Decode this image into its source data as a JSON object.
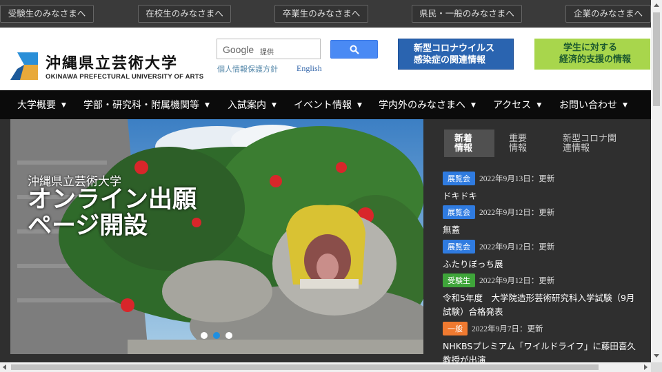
{
  "audience": [
    "受験生のみなさまへ",
    "在校生のみなさまへ",
    "卒業生のみなさまへ",
    "県民・一般のみなさまへ",
    "企業のみなさまへ"
  ],
  "logo": {
    "jp": "沖縄県立芸術大学",
    "en": "OKINAWA PREFECTURAL UNIVERSITY OF ARTS"
  },
  "search": {
    "brand": "Google",
    "provided": "提供",
    "button_icon": "search-icon"
  },
  "links": {
    "privacy": "個人情報保護方針",
    "english": "English"
  },
  "banners": {
    "covid": [
      "新型コロナウイルス",
      "感染症の関連情報"
    ],
    "support": [
      "学生に対する",
      "経済的支援の情報"
    ]
  },
  "nav": [
    "大学概要",
    "学部・研究科・附属機関等",
    "入試案内",
    "イベント情報",
    "学内外のみなさまへ",
    "アクセス",
    "お問い合わせ"
  ],
  "nav_caret": "▼",
  "hero": {
    "subtitle": "沖縄県立芸術大学",
    "title_line1": "オンライン出願",
    "title_line2": "ページ開設",
    "slides": 3,
    "active_slide": 2
  },
  "news_tabs": [
    {
      "line1": "新着",
      "line2": "情報"
    },
    {
      "line1": "重要",
      "line2": "情報"
    },
    {
      "line1": "新型コロナ関",
      "line2": "連情報"
    }
  ],
  "news": [
    {
      "badge": "展覧会",
      "date": "2022年9月13日：更新",
      "title": "ドキドキ",
      "color": "#2f7be0"
    },
    {
      "badge": "展覧会",
      "date": "2022年9月12日：更新",
      "title": "無蓋",
      "color": "#2f7be0"
    },
    {
      "badge": "展覧会",
      "date": "2022年9月12日：更新",
      "title": "ふたりぼっち展",
      "color": "#2f7be0"
    },
    {
      "badge": "受験生",
      "date": "2022年9月12日：更新",
      "title": "令和5年度　大学院造形芸術研究科入学試験（9月試験）合格発表",
      "color": "#3fa53a"
    },
    {
      "badge": "一般",
      "date": "2022年9月7日：更新",
      "title": "NHKBSプレミアム「ワイルドライフ」に藤田喜久教授が出演",
      "color": "#f07a30"
    }
  ]
}
